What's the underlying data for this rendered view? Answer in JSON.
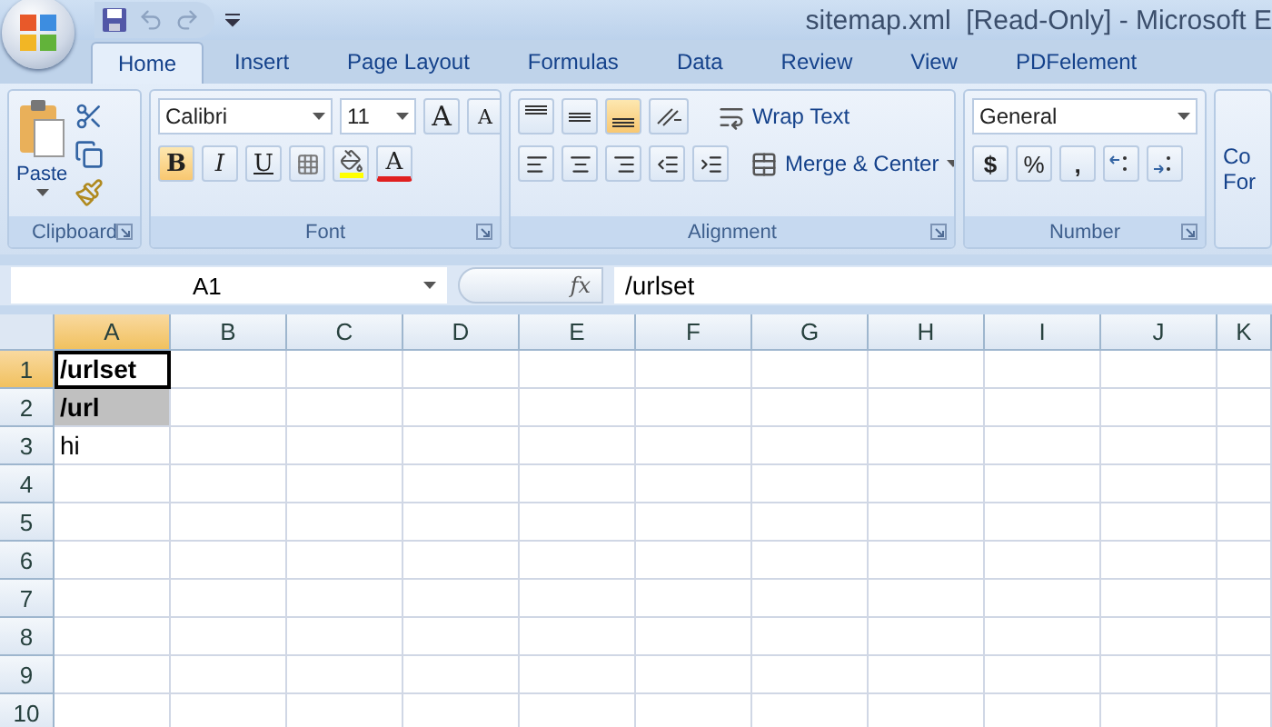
{
  "window": {
    "title": "sitemap.xml  [Read-Only] - Microsoft E"
  },
  "tabs": [
    {
      "label": "Home",
      "selected": true
    },
    {
      "label": "Insert",
      "selected": false
    },
    {
      "label": "Page Layout",
      "selected": false
    },
    {
      "label": "Formulas",
      "selected": false
    },
    {
      "label": "Data",
      "selected": false
    },
    {
      "label": "Review",
      "selected": false
    },
    {
      "label": "View",
      "selected": false
    },
    {
      "label": "PDFelement",
      "selected": false
    }
  ],
  "ribbon": {
    "clipboard": {
      "label": "Clipboard",
      "paste": "Paste"
    },
    "font": {
      "label": "Font",
      "font_name": "Calibri",
      "font_size": "11",
      "grow": "A",
      "shrink": "A",
      "font_color": "A",
      "styles": [
        {
          "kind": "bold",
          "label": "B",
          "on": true
        },
        {
          "kind": "italic",
          "label": "I",
          "on": false
        },
        {
          "kind": "underline",
          "label": "U",
          "on": false
        }
      ]
    },
    "alignment": {
      "label": "Alignment",
      "vertical": [
        {
          "kind": "top",
          "on": false
        },
        {
          "kind": "middle",
          "on": false
        },
        {
          "kind": "bottom",
          "on": true
        }
      ],
      "wrap_text": "Wrap Text",
      "merge": "Merge & Center"
    },
    "number": {
      "label": "Number",
      "format": "General",
      "currency": "$",
      "percent": "%",
      "comma": ","
    },
    "styles_cut": [
      "Co",
      "For"
    ]
  },
  "formula_bar": {
    "name_box": "A1",
    "function_label": "fx",
    "formula": "/urlset"
  },
  "sheet": {
    "columns": [
      {
        "label": "A",
        "selected": true
      },
      {
        "label": "B",
        "selected": false
      },
      {
        "label": "C",
        "selected": false
      },
      {
        "label": "D",
        "selected": false
      },
      {
        "label": "E",
        "selected": false
      },
      {
        "label": "F",
        "selected": false
      },
      {
        "label": "G",
        "selected": false
      },
      {
        "label": "H",
        "selected": false
      },
      {
        "label": "I",
        "selected": false
      },
      {
        "label": "J",
        "selected": false
      },
      {
        "label": "K",
        "selected": false
      }
    ],
    "rows": [
      {
        "label": "1",
        "selected": true,
        "cells": [
          {
            "value": "/urlset",
            "bold": true,
            "active": true,
            "highlighted": false
          }
        ]
      },
      {
        "label": "2",
        "selected": false,
        "cells": [
          {
            "value": "/url",
            "bold": true,
            "active": false,
            "highlighted": true
          }
        ]
      },
      {
        "label": "3",
        "selected": false,
        "cells": [
          {
            "value": "hi",
            "bold": false,
            "active": false,
            "highlighted": false
          }
        ]
      },
      {
        "label": "4",
        "selected": false
      },
      {
        "label": "5",
        "selected": false
      },
      {
        "label": "6",
        "selected": false
      },
      {
        "label": "7",
        "selected": false
      },
      {
        "label": "8",
        "selected": false
      },
      {
        "label": "9",
        "selected": false
      },
      {
        "label": "10",
        "selected": false
      }
    ]
  }
}
